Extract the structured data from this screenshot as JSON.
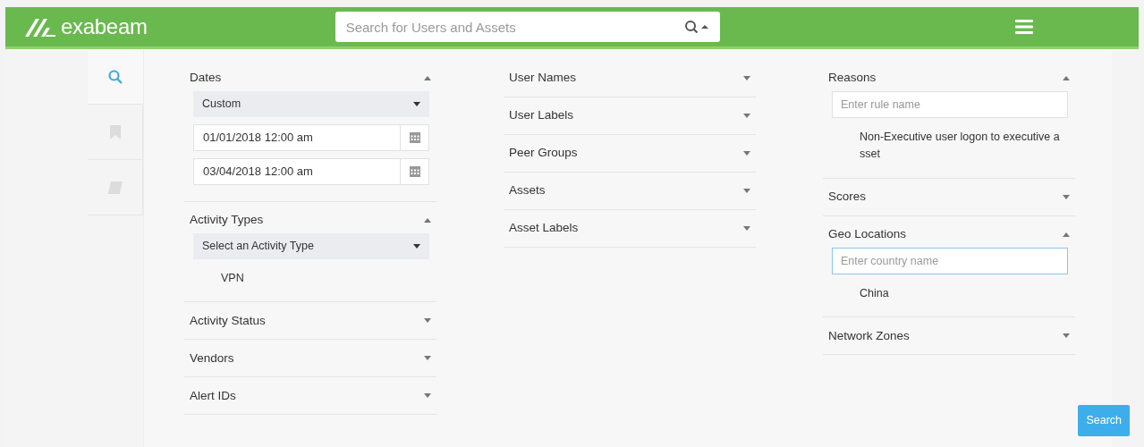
{
  "header": {
    "logo": "exabeam",
    "search": {
      "placeholder": "Search for Users and Assets"
    }
  },
  "sidebar": {
    "tabs": [
      {
        "kind": "search",
        "selected": true
      },
      {
        "kind": "bookmark",
        "selected": false
      },
      {
        "kind": "book",
        "selected": false
      }
    ]
  },
  "columns": [
    {
      "sections": [
        {
          "title": "Dates",
          "expanded": true,
          "contents": [
            {
              "kind": "select",
              "value": "Custom"
            },
            {
              "kind": "date",
              "value": "01/01/2018 12:00 am"
            },
            {
              "kind": "date",
              "value": "03/04/2018 12:00 am"
            }
          ]
        },
        {
          "title": "Activity Types",
          "expanded": true,
          "contents": [
            {
              "kind": "select",
              "value": "Select an Activity Type"
            },
            {
              "kind": "item",
              "text": "VPN"
            }
          ]
        },
        {
          "title": "Activity Status",
          "expanded": false
        },
        {
          "title": "Vendors",
          "expanded": false
        },
        {
          "title": "Alert IDs",
          "expanded": false
        }
      ]
    },
    {
      "sections": [
        {
          "title": "User Names",
          "expanded": false
        },
        {
          "title": "User Labels",
          "expanded": false
        },
        {
          "title": "Peer Groups",
          "expanded": false
        },
        {
          "title": "Assets",
          "expanded": false
        },
        {
          "title": "Asset Labels",
          "expanded": false
        }
      ]
    },
    {
      "sections": [
        {
          "title": "Reasons",
          "expanded": true,
          "contents": [
            {
              "kind": "input",
              "placeholder": "Enter rule name",
              "focused": false
            },
            {
              "kind": "item",
              "text": "Non-Executive user logon to executive a sset"
            }
          ]
        },
        {
          "title": "Scores",
          "expanded": false
        },
        {
          "title": "Geo Locations",
          "expanded": true,
          "contents": [
            {
              "kind": "input",
              "placeholder": "Enter country name",
              "focused": true
            },
            {
              "kind": "item",
              "text": "China"
            }
          ]
        },
        {
          "title": "Network Zones",
          "expanded": false
        }
      ]
    }
  ],
  "search_button": "Search"
}
